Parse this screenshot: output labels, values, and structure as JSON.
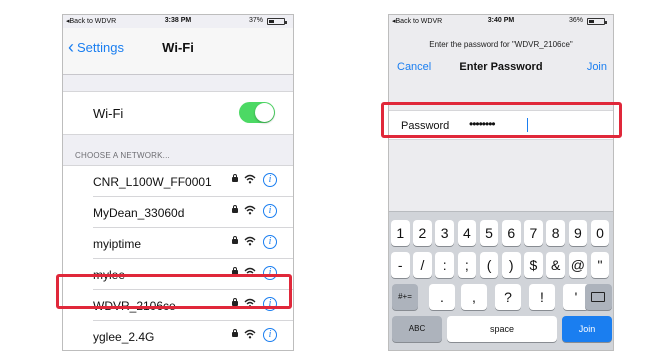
{
  "left_screen": {
    "status": {
      "back": "◂Back to WDVR",
      "time": "3:38 PM",
      "battery": "37%",
      "battery_fill": 0.37
    },
    "nav": {
      "back_label": "Settings",
      "title": "Wi-Fi"
    },
    "wifi_row": {
      "label": "Wi-Fi",
      "enabled": true
    },
    "section_header": "CHOOSE A NETWORK...",
    "networks": [
      {
        "name": "CNR_L100W_FF0001"
      },
      {
        "name": "MyDean_33060d"
      },
      {
        "name": "myiptime"
      },
      {
        "name": "mylee"
      },
      {
        "name": "WDVR_2106ce",
        "highlighted": true
      },
      {
        "name": "yglee_2.4G"
      }
    ],
    "icons": {
      "lock": "lock-icon",
      "wifi": "wifi-icon",
      "info": "info-icon"
    },
    "info_glyph": "i"
  },
  "right_screen": {
    "status": {
      "back": "◂Back to WDVR",
      "time": "3:40 PM",
      "battery": "36%",
      "battery_fill": 0.36
    },
    "prompt": "Enter the password for \"WDVR_2106ce\"",
    "nav": {
      "cancel": "Cancel",
      "title": "Enter Password",
      "join": "Join"
    },
    "password": {
      "label": "Password",
      "value": "••••••••"
    },
    "keyboard": {
      "row1": [
        "1",
        "2",
        "3",
        "4",
        "5",
        "6",
        "7",
        "8",
        "9",
        "0"
      ],
      "row2": [
        "-",
        "/",
        ":",
        ";",
        "(",
        ")",
        "$",
        "&",
        "@",
        "\""
      ],
      "switch_label": "#+=",
      "row3": [
        ".",
        ",",
        "?",
        "!",
        "'"
      ],
      "abc_label": "ABC",
      "space_label": "space",
      "join_label": "Join"
    }
  },
  "colors": {
    "accent": "#1a7ef0",
    "toggle_on": "#4cd964",
    "highlight": "#e0283a"
  }
}
